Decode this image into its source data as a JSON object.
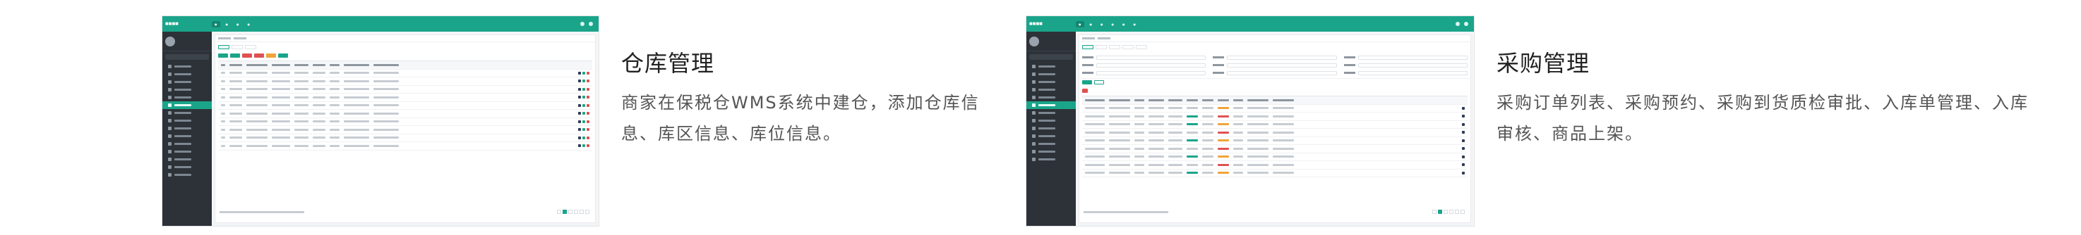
{
  "section_warehouse": {
    "title": "仓库管理",
    "description": "商家在保税仓WMS系统中建仓，添加仓库信息、库区信息、库位信息。"
  },
  "section_purchase": {
    "title": "采购管理",
    "description": "采购订单列表、采购预约、采购到货质检审批、入库单管理、入库审核、商品上架。"
  },
  "colors": {
    "accent": "#1aa58a",
    "sidebar": "#2d3238",
    "title_text": "#222222",
    "desc_text": "#555555",
    "button_red": "#e05252",
    "button_orange": "#f0a43a",
    "button_dark": "#2f3b52"
  }
}
